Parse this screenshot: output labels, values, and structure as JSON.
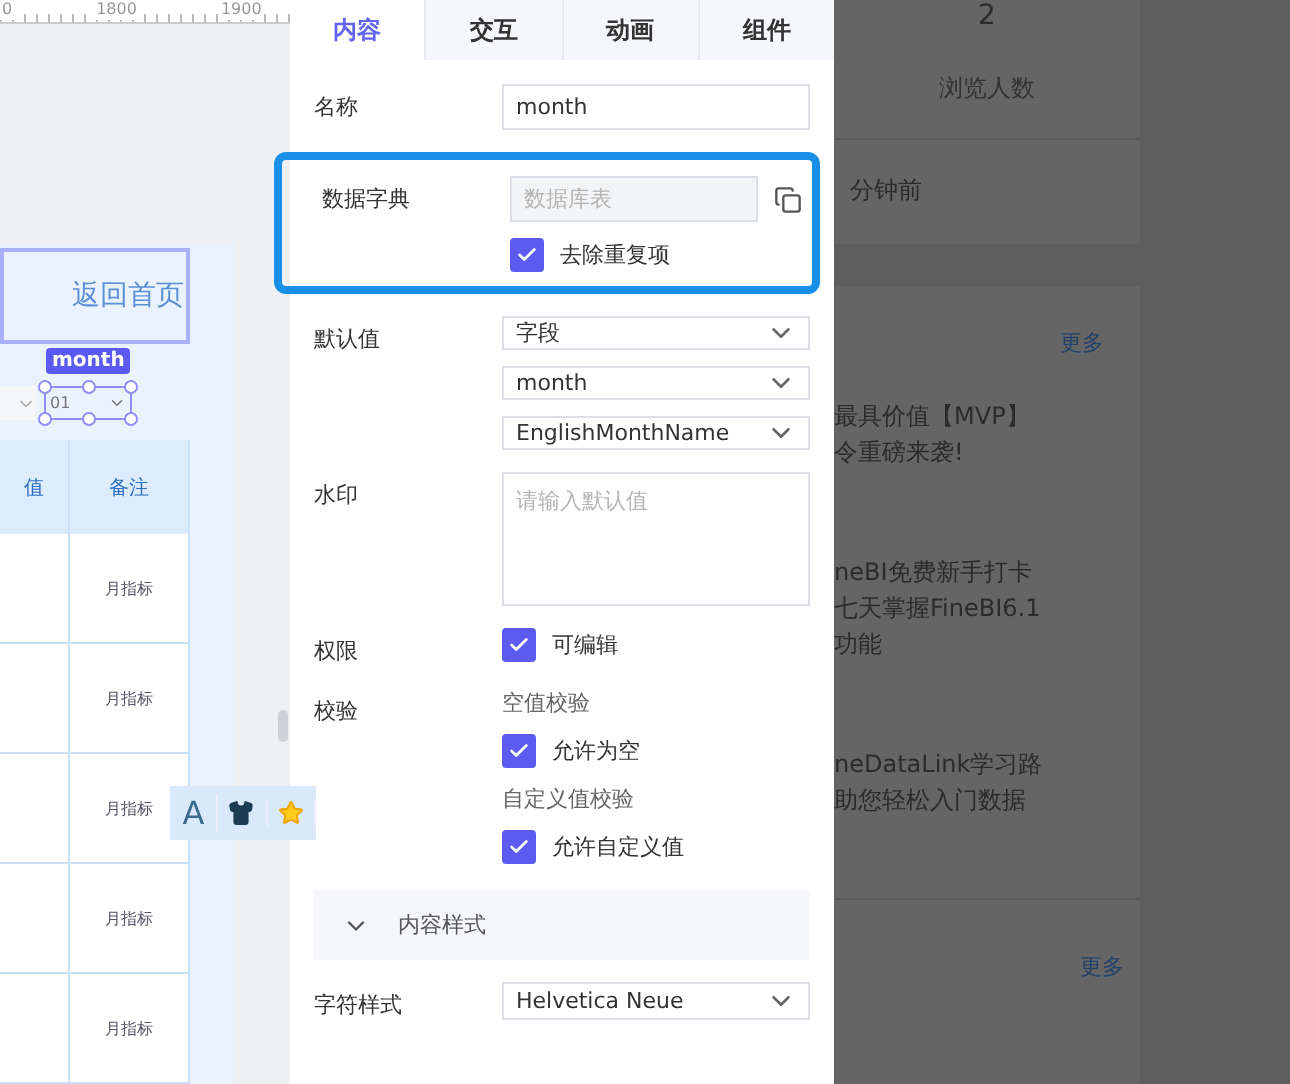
{
  "canvas": {
    "ruler_labels": [
      "0",
      "1800",
      "1900"
    ],
    "back_button": "返回首页",
    "selected_widget": {
      "badge": "month",
      "value": "01"
    },
    "table": {
      "columns": [
        "值",
        "备注"
      ],
      "rows": [
        [
          "",
          "月指标"
        ],
        [
          "",
          "月指标"
        ],
        [
          "",
          "月指标"
        ],
        [
          "",
          "月指标"
        ],
        [
          "",
          "月指标"
        ]
      ]
    },
    "toolbar_letter": "A"
  },
  "panel": {
    "tabs": [
      {
        "label": "内容",
        "selected": true
      },
      {
        "label": "交互",
        "selected": false
      },
      {
        "label": "动画",
        "selected": false
      },
      {
        "label": "组件",
        "selected": false
      }
    ],
    "rows": [
      {
        "label": "名称",
        "highlighted": false,
        "items": [
          {
            "kind": "input",
            "value": "month"
          }
        ]
      },
      {
        "label": "数据字典",
        "highlighted": true,
        "items": [
          {
            "kind": "input",
            "placeholder": "数据库表",
            "disabled": true,
            "copy": true
          },
          {
            "kind": "checkbox",
            "label": "去除重复项",
            "checked": true
          }
        ]
      },
      {
        "label": "默认值",
        "highlighted": false,
        "items": [
          {
            "kind": "select",
            "value": "字段"
          },
          {
            "kind": "select",
            "value": "month"
          },
          {
            "kind": "select",
            "value": "EnglishMonthName"
          }
        ]
      },
      {
        "label": "水印",
        "highlighted": false,
        "items": [
          {
            "kind": "textarea",
            "placeholder": "请输入默认值"
          }
        ]
      },
      {
        "label": "权限",
        "highlighted": false,
        "items": [
          {
            "kind": "checkbox",
            "label": "可编辑",
            "checked": true
          }
        ]
      },
      {
        "label": "校验",
        "highlighted": false,
        "items": [
          {
            "kind": "sublabel",
            "label": "空值校验"
          },
          {
            "kind": "checkbox",
            "label": "允许为空",
            "checked": true
          },
          {
            "kind": "sublabel",
            "label": "自定义值校验"
          },
          {
            "kind": "checkbox",
            "label": "允许自定义值",
            "checked": true
          }
        ]
      }
    ],
    "section": {
      "title": "内容样式",
      "expanded": true
    },
    "style_rows": [
      {
        "label": "字符样式",
        "items": [
          {
            "kind": "select",
            "value": "Helvetica Neue"
          }
        ]
      }
    ]
  },
  "background": {
    "stat_value": "2",
    "stat_label": "浏览人数",
    "updated": "分钟前",
    "more_links": [
      "更多",
      "更多"
    ],
    "news": [
      {
        "lines": [
          "最具价值【MVP】",
          "令重磅来袭!"
        ]
      },
      {
        "lines": [
          "neBI免费新手打卡",
          "七天掌握FineBI6.1",
          "功能"
        ]
      },
      {
        "lines": [
          "neDataLink学习路",
          "助您轻松入门数据"
        ]
      }
    ]
  }
}
